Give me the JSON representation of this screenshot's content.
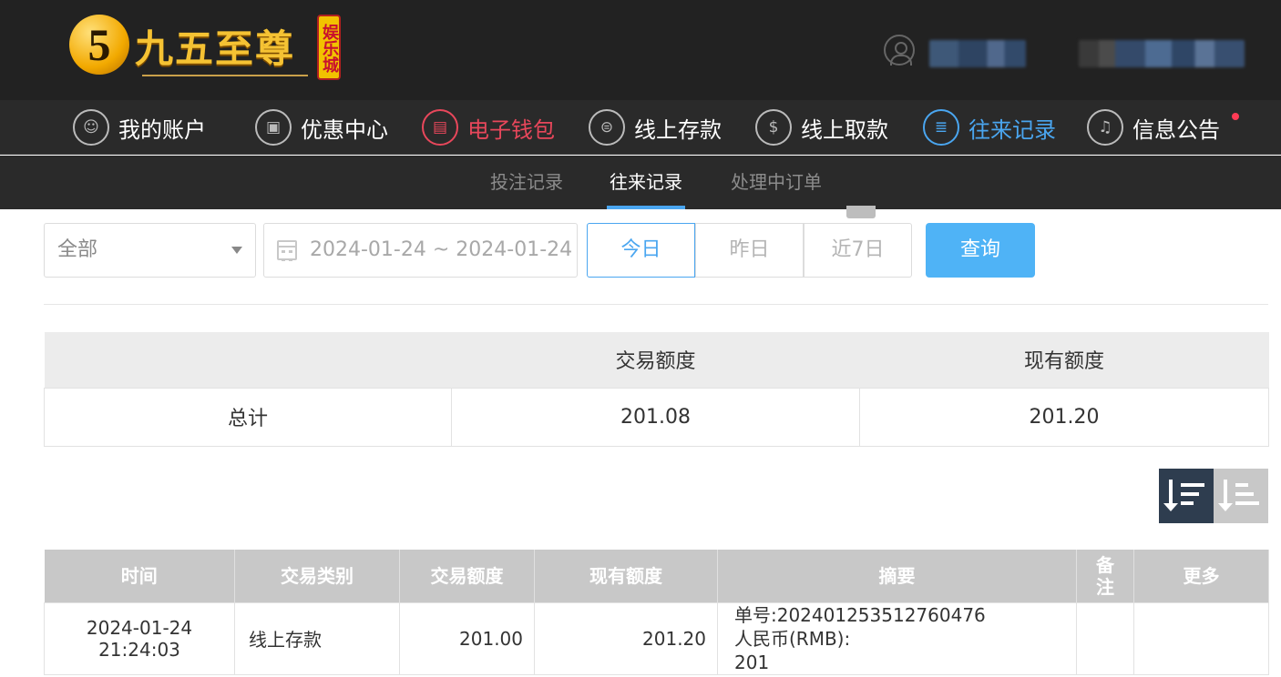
{
  "brand": {
    "mark": "5",
    "name": "九五至尊",
    "seal": "娱乐城"
  },
  "nav": [
    {
      "label": "我的账户",
      "icon": "user-circle-icon",
      "glyph": "☺"
    },
    {
      "label": "优惠中心",
      "icon": "gift-icon",
      "glyph": "▣"
    },
    {
      "label": "电子钱包",
      "icon": "wallet-icon",
      "glyph": "▤"
    },
    {
      "label": "线上存款",
      "icon": "deposit-icon",
      "glyph": "⊜"
    },
    {
      "label": "线上取款",
      "icon": "withdraw-icon",
      "glyph": "$"
    },
    {
      "label": "往来记录",
      "icon": "records-icon",
      "glyph": "≣"
    },
    {
      "label": "信息公告",
      "icon": "bell-icon",
      "glyph": "♫"
    }
  ],
  "subtabs": [
    "投注记录",
    "往来记录",
    "处理中订单"
  ],
  "filter": {
    "type": "全部",
    "date_range": "2024-01-24 ~ 2024-01-24",
    "quick": [
      "今日",
      "昨日",
      "近7日"
    ],
    "query": "查询"
  },
  "summary": {
    "headers": [
      "",
      "交易额度",
      "现有额度"
    ],
    "row": [
      "总计",
      "201.08",
      "201.20"
    ]
  },
  "detail": {
    "headers": [
      "时间",
      "交易类别",
      "交易额度",
      "现有额度",
      "摘要",
      "备注",
      "更多"
    ],
    "rows": [
      {
        "time": "2024-01-24 21:24:03",
        "type": "线上存款",
        "amount": "201.00",
        "balance": "201.20",
        "memo": [
          "单号:202401253512760476",
          "人民币(RMB):",
          "201"
        ],
        "note": "",
        "more": ""
      }
    ]
  },
  "colors": {
    "accent_blue": "#4aa6f0",
    "accent_red": "#e8475b",
    "query_button": "#4fb3f6",
    "header_bg": "#222222"
  }
}
